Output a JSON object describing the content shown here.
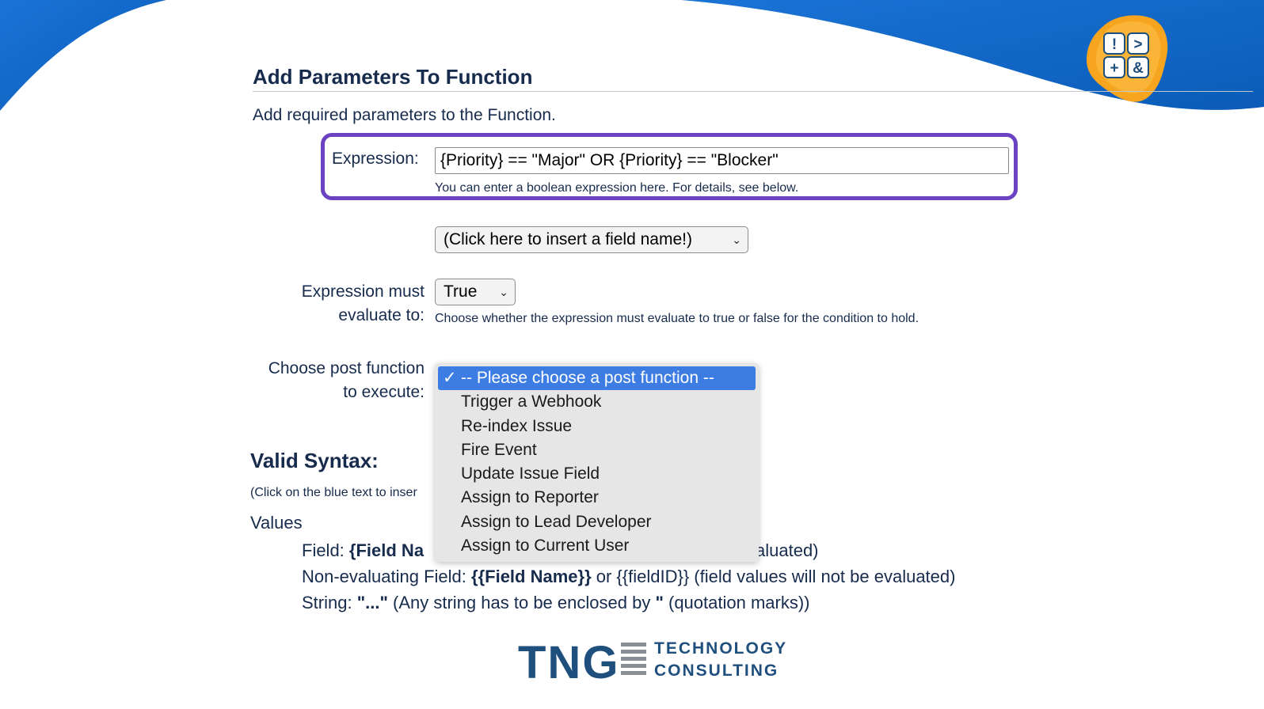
{
  "header": {
    "title": "Add Parameters To Function",
    "description": "Add required parameters to the Function."
  },
  "expression": {
    "label": "Expression:",
    "value": "{Priority} == \"Major\" OR {Priority} == \"Blocker\"",
    "help": "You can enter a boolean expression here. For details, see below."
  },
  "field_insert": {
    "label": "(Click here to insert a field name!)"
  },
  "evaluate": {
    "label_line1": "Expression must",
    "label_line2": "evaluate to:",
    "value": "True",
    "help": "Choose whether the expression must evaluate to true or false for the condition to hold."
  },
  "post_function": {
    "label_line1": "Choose post function",
    "label_line2": "to execute:",
    "options": [
      "-- Please choose a post function --",
      "Trigger a Webhook",
      "Re-index Issue",
      "Fire Event",
      "Update Issue Field",
      "Assign to Reporter",
      "Assign to Lead Developer",
      "Assign to Current User"
    ],
    "check_mark": "✓"
  },
  "syntax": {
    "heading": "Valid Syntax:",
    "hint": "(Click on the blue text to inser",
    "values_heading": "Values",
    "field_prefix": "Field: ",
    "field_bold": "{Field Na",
    "field_tail": "aluated)",
    "nonevaluating_prefix": "Non-evaluating Field: ",
    "nonevaluating_bold": "{{Field Name}}",
    "nonevaluating_tail": " or {{fieldID}} (field values will not be evaluated)",
    "string_prefix": "String: ",
    "string_bold": "\"...\"",
    "string_mid": " (Any string has to be enclosed by ",
    "string_quote": "\"",
    "string_tail": " (quotation marks))"
  },
  "branding": {
    "logo_word": "TNG",
    "logo_line1": "TECHNOLOGY",
    "logo_line2": "CONSULTING",
    "badge_glyphs": [
      "!",
      ">",
      "+",
      "&"
    ]
  },
  "colors": {
    "accent_wave": "#1a73d6",
    "highlight_border": "#6a42c2",
    "selected_option": "#3d7de3",
    "badge_orange": "#f7a51f"
  }
}
